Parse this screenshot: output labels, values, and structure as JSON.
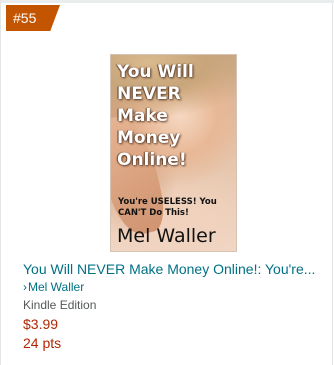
{
  "rank": {
    "label": "#55",
    "color": "#c45500"
  },
  "book": {
    "cover": {
      "title": "You Will NEVER Make Money Online!",
      "subtitle": "You're USELESS! You CAN'T Do This!",
      "author": "Mel Waller"
    },
    "title": "You Will NEVER Make Money Online!: You're...",
    "author_prefix": "›",
    "author": "Mel Waller",
    "format": "Kindle Edition",
    "price": "$3.99",
    "points": "24 pts"
  },
  "colors": {
    "link": "#007185",
    "price": "#b12704",
    "secondary_text": "#565959"
  }
}
